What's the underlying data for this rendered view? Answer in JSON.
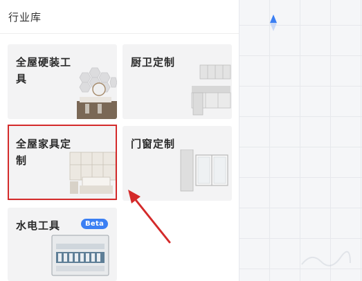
{
  "panel": {
    "title": "行业库"
  },
  "cards": [
    {
      "label": "全屋硬装工具"
    },
    {
      "label": "厨卫定制"
    },
    {
      "label": "全屋家具定制"
    },
    {
      "label": "门窗定制"
    },
    {
      "label": "水电工具",
      "badge": "Beta"
    }
  ],
  "colors": {
    "highlight": "#d42a2a",
    "badge": "#3b7ff3",
    "compass": "#3b7ff3"
  },
  "icons": [
    "compass-icon",
    "annotation-arrow"
  ]
}
